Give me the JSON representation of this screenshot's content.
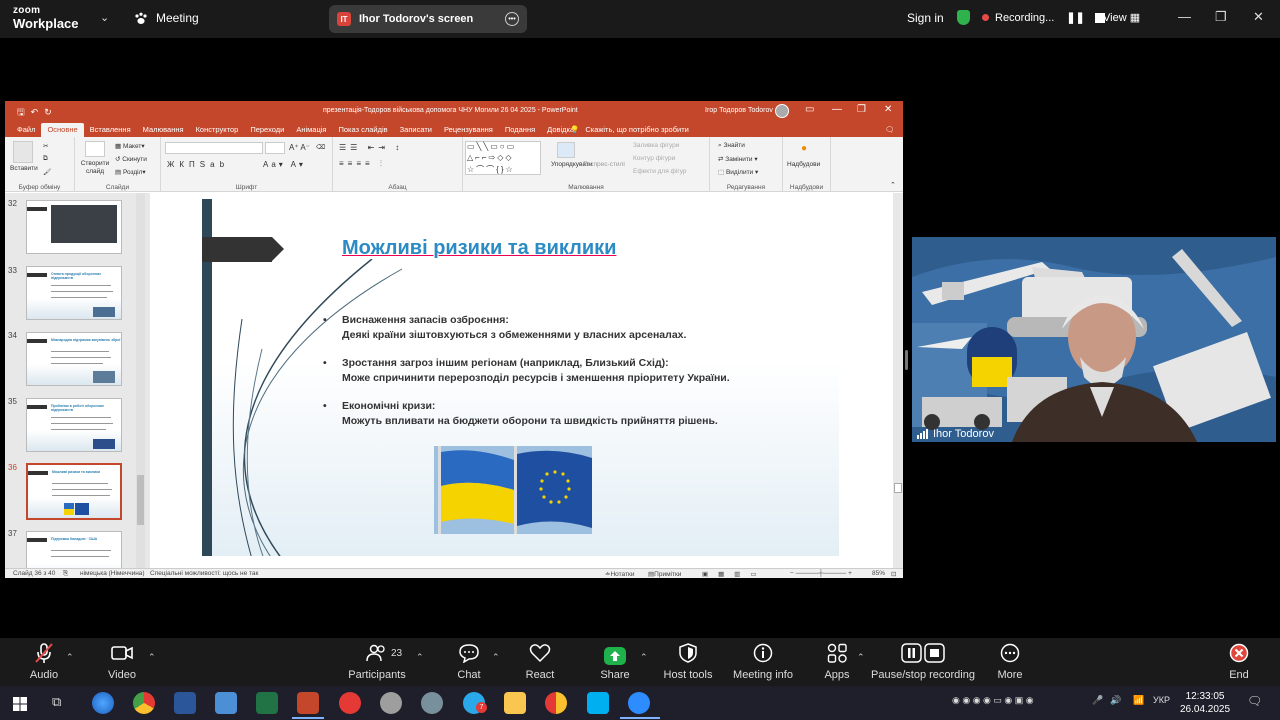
{
  "zoom": {
    "logo_line1": "zoom",
    "logo_line2": "Workplace",
    "meeting_label": "Meeting",
    "share_initials": "IT",
    "share_label": "Ihor Todorov's screen",
    "sign_in": "Sign in",
    "recording": "Recording...",
    "view": "View"
  },
  "ppt": {
    "doc_title": "презентація-Тодоров військова допомога ЧНУ Могили 26 04 2025  -  PowerPoint",
    "user": "Ігор Тодоров Todorov",
    "tabs": [
      "Файл",
      "Основне",
      "Вставлення",
      "Малювання",
      "Конструктор",
      "Переходи",
      "Анімація",
      "Показ слайдів",
      "Записати",
      "Рецензування",
      "Подання",
      "Довідка"
    ],
    "tell_me": "Скажіть, що потрібно зробити",
    "ribbon": {
      "paste": "Вставити",
      "clipboard": "Буфер обміну",
      "new_slide": "Створити слайд",
      "layout": "Макет",
      "reset": "Скинути",
      "section": "Розділ",
      "slides": "Слайди",
      "font": "Шрифт",
      "paragraph": "Абзац",
      "arrange": "Упорядкувати",
      "quick_styles": "Експрес-стилі",
      "shape_fill": "Заливка фігури",
      "shape_outline": "Контур фігури",
      "shape_effects": "Ефекти для фігур",
      "drawing": "Малювання",
      "find": "Знайти",
      "replace": "Замінити",
      "select": "Виділити",
      "editing": "Редагування",
      "addins_btn": "Надбудови",
      "addins": "Надбудови"
    },
    "thumbnails": [
      {
        "num": "32",
        "title": ""
      },
      {
        "num": "33",
        "title": "Оплата продукції оборонних підприємств"
      },
      {
        "num": "34",
        "title": "Міжнародна підтримка закупівель зброї"
      },
      {
        "num": "35",
        "title": "Проблеми в роботі оборонних підприємств"
      },
      {
        "num": "36",
        "title": "Можливі ризики та виклики"
      },
      {
        "num": "37",
        "title": "Підтримка Канадою · США"
      }
    ],
    "slide": {
      "title": "Можливі ризики та виклики",
      "bullets": [
        {
          "head": "Виснаження запасів озброєння:",
          "body": "Деякі країни зіштовхуються з обмеженнями у власних арсеналах."
        },
        {
          "head": "Зростання загроз іншим регіонам (наприклад, Близький Схід):",
          "body": "Може спричинити перерозподіл ресурсів і зменшення пріоритету України."
        },
        {
          "head": "Економічні кризи:",
          "body": "Можуть впливати на бюджети оборони та швидкість прийняття рішень."
        }
      ]
    },
    "status": {
      "slide_of": "Слайд 36 з 40",
      "language": "німецька (Німеччина)",
      "accessibility": "Спеціальні можливості: щось не так",
      "notes": "Нотатки",
      "comments": "Примітки",
      "zoom": "85%"
    }
  },
  "participant": {
    "name": "Ihor Todorov"
  },
  "toolbar": {
    "audio": "Audio",
    "video": "Video",
    "participants": "Participants",
    "participants_count": "23",
    "chat": "Chat",
    "react": "React",
    "share": "Share",
    "host_tools": "Host tools",
    "meeting_info": "Meeting info",
    "apps": "Apps",
    "pause_recording": "Pause/stop recording",
    "more": "More",
    "end": "End"
  },
  "taskbar": {
    "language": "УКР",
    "time": "12:33:05",
    "date": "26.04.2025",
    "chrome_badge": "7"
  },
  "colors": {
    "ppt_accent": "#c4472b",
    "slide_title": "#2b8bc4",
    "zoom_bg": "#1a1a1a",
    "share_green": "#1fb14b",
    "end_red": "#e0463c"
  }
}
